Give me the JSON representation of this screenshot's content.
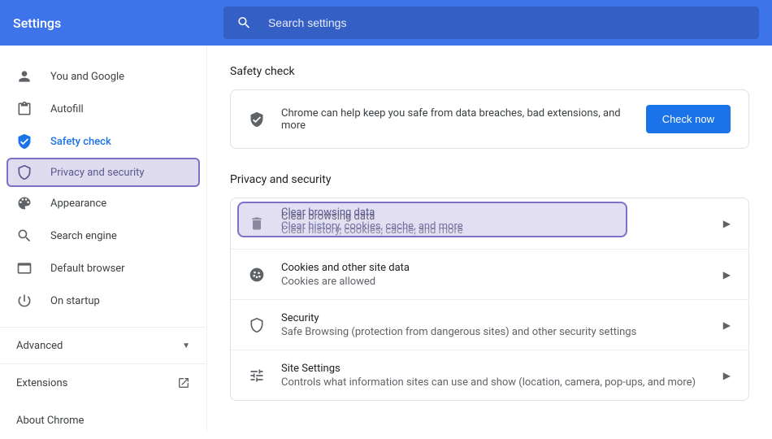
{
  "header": {
    "title": "Settings",
    "search_placeholder": "Search settings"
  },
  "sidebar": {
    "items": [
      {
        "label": "You and Google"
      },
      {
        "label": "Autofill"
      },
      {
        "label": "Safety check"
      },
      {
        "label": "Privacy and security"
      },
      {
        "label": "Appearance"
      },
      {
        "label": "Search engine"
      },
      {
        "label": "Default browser"
      },
      {
        "label": "On startup"
      }
    ],
    "advanced": "Advanced",
    "extensions": "Extensions",
    "about": "About Chrome"
  },
  "safety": {
    "heading": "Safety check",
    "text": "Chrome can help keep you safe from data breaches, bad extensions, and more",
    "button": "Check now"
  },
  "privacy": {
    "heading": "Privacy and security",
    "rows": [
      {
        "title": "Clear browsing data",
        "sub": "Clear history, cookies, cache, and more"
      },
      {
        "title": "Cookies and other site data",
        "sub": "Cookies are allowed"
      },
      {
        "title": "Security",
        "sub": "Safe Browsing (protection from dangerous sites) and other security settings"
      },
      {
        "title": "Site Settings",
        "sub": "Controls what information sites can use and show (location, camera, pop-ups, and more)"
      }
    ]
  }
}
